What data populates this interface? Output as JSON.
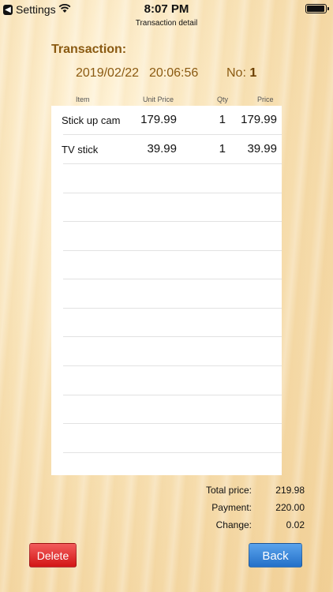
{
  "status_bar": {
    "back_app": "Settings",
    "time": "8:07 PM"
  },
  "nav": {
    "title": "Transaction detail"
  },
  "transaction": {
    "heading": "Transaction:",
    "date": "2019/02/22",
    "time": "20:06:56",
    "no_label": "No:",
    "no_value": "1"
  },
  "table": {
    "headers": {
      "item": "Item",
      "unit_price": "Unit Price",
      "qty": "Qty",
      "price": "Price"
    },
    "rows": [
      {
        "item": "Stick up cam",
        "unit_price": "179.99",
        "qty": "1",
        "price": "179.99"
      },
      {
        "item": "TV stick",
        "unit_price": "39.99",
        "qty": "1",
        "price": "39.99"
      }
    ]
  },
  "totals": {
    "total_label": "Total price:",
    "total_value": "219.98",
    "payment_label": "Payment:",
    "payment_value": "220.00",
    "change_label": "Change:",
    "change_value": "0.02"
  },
  "buttons": {
    "delete": "Delete",
    "back": "Back"
  },
  "colors": {
    "accent_brown": "#8a5a12",
    "delete_red": "#d21515",
    "back_blue": "#2470c8"
  }
}
